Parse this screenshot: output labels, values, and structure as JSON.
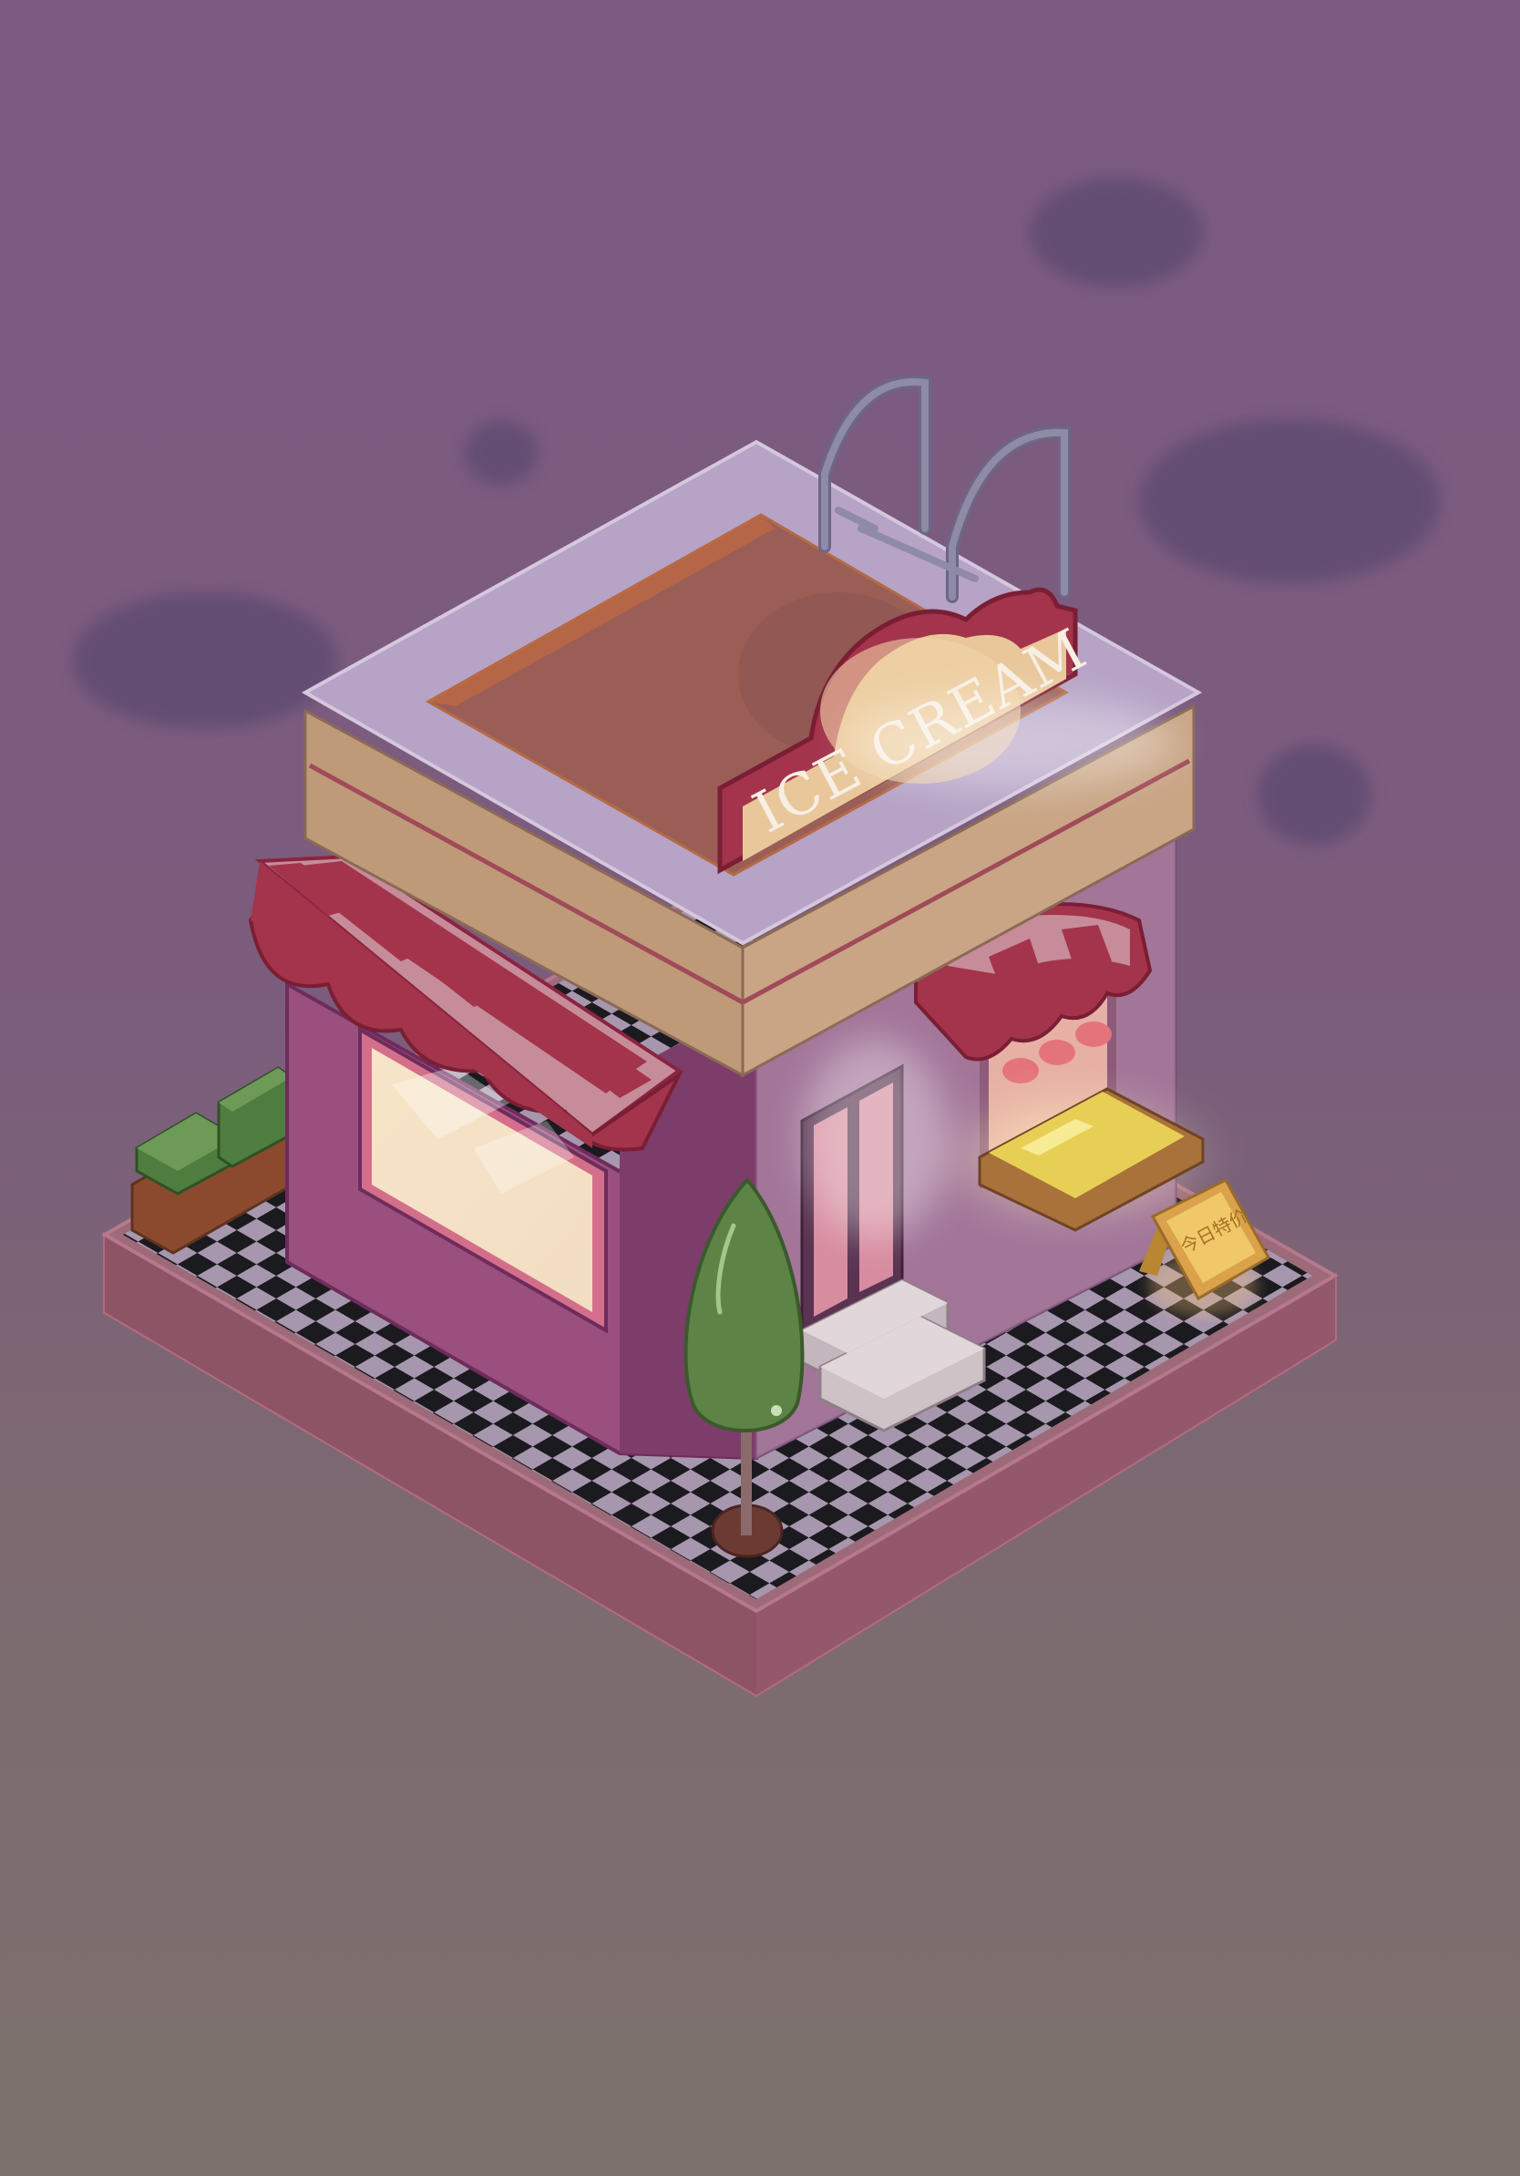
{
  "scene": {
    "shop_sign": "ICE CREAM",
    "board_sign": "今日特价"
  },
  "colors": {
    "sky_top": "#7b5a80",
    "sky_bottom": "#7c716c",
    "cloud": "#644e73",
    "wall_pink": "#9a4f7e",
    "awning_red": "#a3344b",
    "awning_stripe": "#c68c9a",
    "roof_frame": "#b6a3c6",
    "roof_inner": "#9a5e57",
    "sign_bg": "#e9c79b",
    "tree_green": "#5d8347",
    "checker_dark": "#1a1a1f",
    "checker_light": "#a797ae"
  }
}
